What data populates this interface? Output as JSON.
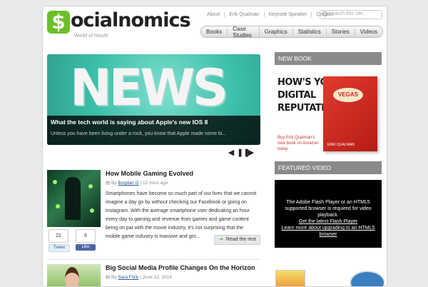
{
  "brand": {
    "logo_mark": "$",
    "logo_text": "ocialnomics",
    "tagline": "World of Mouth"
  },
  "top_links": [
    "About",
    "Erik Qualman",
    "Keynote Speaker",
    "Contact"
  ],
  "search": {
    "placeholder": "Search this site..."
  },
  "nav": [
    "Books",
    "Case Studies",
    "Graphics",
    "Statistics",
    "Stories",
    "Videos"
  ],
  "hero": {
    "image_word": "NEWS",
    "title": "What the tech world is saying about Apple's new IOS 8",
    "excerpt": "Unless you have been living under a rock, you know that Apple made some bi..."
  },
  "pager": {
    "prev": "◀",
    "pause": "❚❚",
    "next": "▶"
  },
  "posts": [
    {
      "title": "How Mobile Gaming Evolved",
      "by": "By",
      "author": "Bogdan O",
      "date": "12 mins ago",
      "excerpt": "Smartphones have become so much part of our lives that we cannot imagine a day go by without checking our Facebook or going on Instagram. With the average smartphone user dedicating an hour every day to gaming and revenue from games and game content being on par with the movie industry, it's not surprising that the mobile game industry is massive and gro...",
      "tweet_count": "22",
      "like_count": "6",
      "tweet_label": "Tweet",
      "like_label": "Like",
      "read_more": "Read the rest"
    },
    {
      "title": "Big Social Media Profile Changes On the Horizon",
      "by": "By",
      "author": "Sara Flick",
      "date": "June 12, 2014"
    }
  ],
  "sidebar": {
    "new_book_heading": "NEW BOOK",
    "book_lines": [
      "HOW'S YOUR",
      "DIGITAL",
      "REPUTATION?"
    ],
    "book_cover_word": "VEGAS",
    "book_cover_author": "ERIK QUALMAN",
    "book_cta": "Buy Erik Qualman's new book on Amazon today.",
    "featured_video_heading": "FEATURED VIDEO",
    "video_message": "The Adobe Flash Player or an HTML5 supported browser is required for video playback.",
    "video_link1": "Get the latest Flash Player",
    "video_link2": "Learn more about upgrading to an HTML5 browser"
  },
  "colors": {
    "brand_green": "#6bbf2a",
    "hero_teal": "#3cbfa9",
    "widget_grey": "#8a8a8a",
    "link_blue": "#2a5599"
  }
}
